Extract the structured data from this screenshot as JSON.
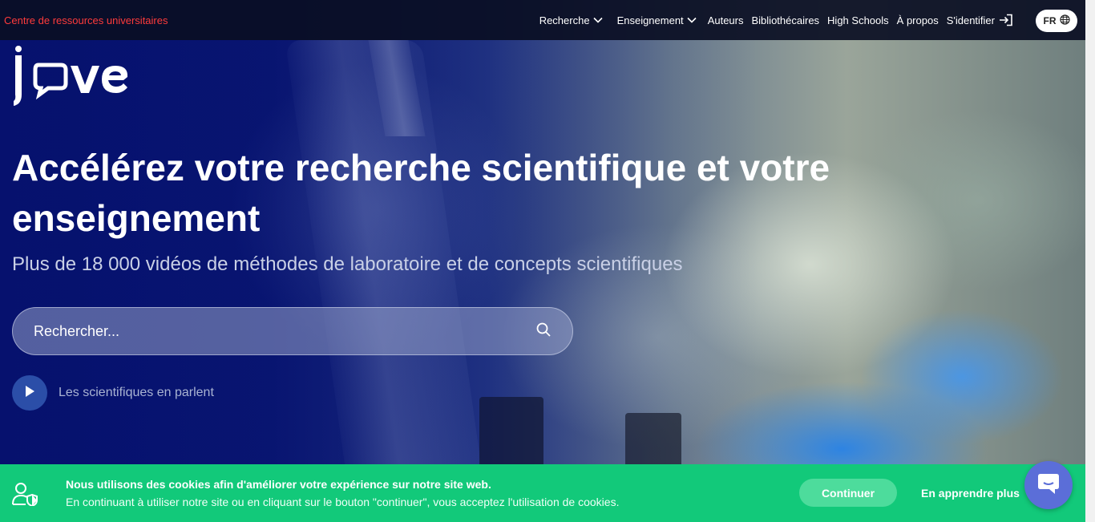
{
  "topbar": {
    "resource_center": "Centre de ressources universitaires",
    "nav": [
      {
        "label": "Recherche",
        "has_dropdown": true
      },
      {
        "label": "Enseignement",
        "has_dropdown": true
      },
      {
        "label": "Auteurs",
        "has_dropdown": false
      },
      {
        "label": "Bibliothécaires",
        "has_dropdown": false
      },
      {
        "label": "High Schools",
        "has_dropdown": false
      },
      {
        "label": "À propos",
        "has_dropdown": false
      },
      {
        "label": "S'identifier",
        "has_dropdown": false
      }
    ],
    "language": "FR"
  },
  "logo": {
    "text": "jove"
  },
  "hero": {
    "headline": "Accélérez votre recherche scientifique et votre enseignement",
    "subheadline": "Plus de 18 000 vidéos de méthodes de laboratoire et de concepts scientifiques",
    "search_placeholder": "Rechercher...",
    "video_label": "Les scientifiques en parlent"
  },
  "cookie": {
    "title": "Nous utilisons des cookies afin d'améliorer votre expérience sur notre site web.",
    "text": "En continuant à utiliser notre site ou en cliquant sur le bouton \"continuer\", vous acceptez l'utilisation de cookies.",
    "continue_label": "Continuer",
    "learn_more_label": "En apprendre plus"
  },
  "colors": {
    "resource_center": "#ff3b3b",
    "cookie_bar": "#12c97a",
    "continue_button": "#4ddc9c",
    "chat_button": "#5b6ed8",
    "play_button": "#2b4ea8"
  },
  "icons": {
    "nav_dropdown": "chevron-down-icon",
    "sign_in": "sign-in-icon",
    "language": "globe-icon",
    "search": "search-icon",
    "play": "play-icon",
    "cookie": "user-shield-icon",
    "chat": "chat-icon"
  }
}
